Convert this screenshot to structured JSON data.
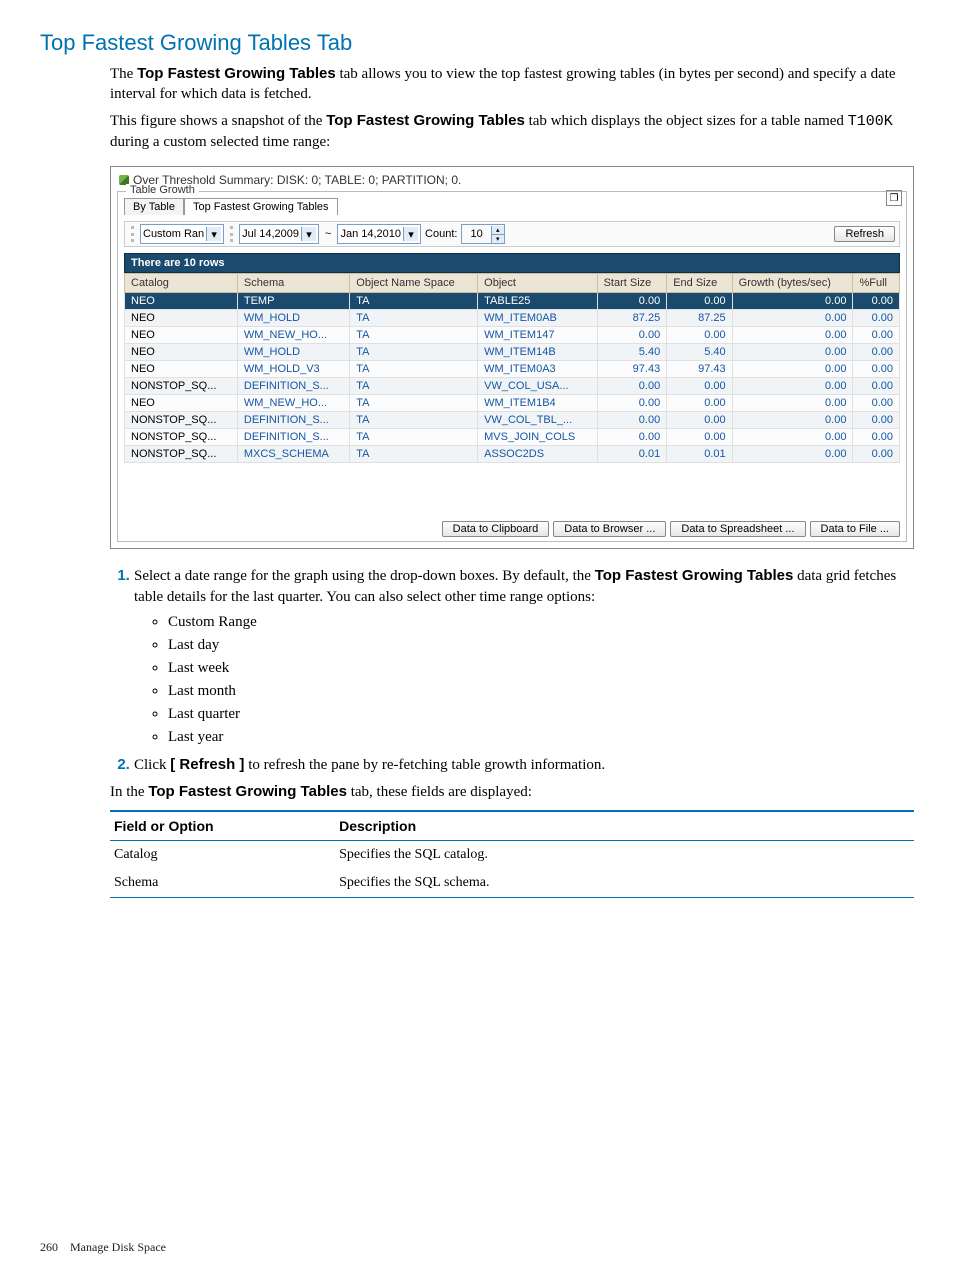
{
  "page": {
    "title": "Top Fastest Growing Tables Tab",
    "intro1_a": "The ",
    "intro1_b": "Top Fastest Growing Tables",
    "intro1_c": " tab allows you to view the top fastest growing tables (in bytes per second) and specify a date interval for which data is fetched.",
    "intro2_a": "This figure shows a snapshot of the ",
    "intro2_b": "Top Fastest Growing Tables",
    "intro2_c": " tab which displays the object sizes for a table named ",
    "intro2_code": "T100K",
    "intro2_d": " during a custom selected time range:",
    "step1_a": "Select a date range for the graph using the drop-down boxes. By default, the ",
    "step1_b": "Top Fastest Growing Tables",
    "step1_c": " data grid fetches table details for the last quarter. You can also select other time range options:",
    "range_options": [
      "Custom Range",
      "Last day",
      "Last week",
      "Last month",
      "Last quarter",
      "Last year"
    ],
    "step2_a": "Click ",
    "step2_b": "[ Refresh ]",
    "step2_c": " to refresh the pane by re-fetching table growth information.",
    "fields_intro_a": "In the ",
    "fields_intro_b": "Top Fastest Growing Tables",
    "fields_intro_c": " tab, these fields are displayed:",
    "field_header1": "Field or Option",
    "field_header2": "Description",
    "fields": [
      {
        "name": "Catalog",
        "desc": "Specifies the SQL catalog."
      },
      {
        "name": "Schema",
        "desc": "Specifies the SQL schema."
      }
    ],
    "footer_page": "260",
    "footer_text": "Manage Disk Space"
  },
  "screenshot": {
    "window_title": "Over Threshold Summary: DISK: 0; TABLE: 0; PARTITION; 0.",
    "fieldset_legend": "Table Growth",
    "tab1": "By Table",
    "tab2": "Top Fastest Growing Tables",
    "range_dropdown": "Custom Ran",
    "date_from": "Jul 14,2009",
    "date_to": "Jan 14,2010",
    "count_label": "Count:",
    "count_value": "10",
    "refresh_btn": "Refresh",
    "rows_label": "There are 10 rows",
    "grid_headers": [
      "Catalog",
      "Schema",
      "Object Name Space",
      "Object",
      "Start Size",
      "End Size",
      "Growth (bytes/sec)",
      "%Full"
    ],
    "grid_rows": [
      {
        "sel": true,
        "cells": [
          "NEO",
          "TEMP",
          "TA",
          "TABLE25",
          "0.00",
          "0.00",
          "0.00",
          "0.00"
        ]
      },
      {
        "sel": false,
        "cells": [
          "NEO",
          "WM_HOLD",
          "TA",
          "WM_ITEM0AB",
          "87.25",
          "87.25",
          "0.00",
          "0.00"
        ]
      },
      {
        "sel": false,
        "cells": [
          "NEO",
          "WM_NEW_HO...",
          "TA",
          "WM_ITEM147",
          "0.00",
          "0.00",
          "0.00",
          "0.00"
        ]
      },
      {
        "sel": false,
        "cells": [
          "NEO",
          "WM_HOLD",
          "TA",
          "WM_ITEM14B",
          "5.40",
          "5.40",
          "0.00",
          "0.00"
        ]
      },
      {
        "sel": false,
        "cells": [
          "NEO",
          "WM_HOLD_V3",
          "TA",
          "WM_ITEM0A3",
          "97.43",
          "97.43",
          "0.00",
          "0.00"
        ]
      },
      {
        "sel": false,
        "cells": [
          "NONSTOP_SQ...",
          "DEFINITION_S...",
          "TA",
          "VW_COL_USA...",
          "0.00",
          "0.00",
          "0.00",
          "0.00"
        ]
      },
      {
        "sel": false,
        "cells": [
          "NEO",
          "WM_NEW_HO...",
          "TA",
          "WM_ITEM1B4",
          "0.00",
          "0.00",
          "0.00",
          "0.00"
        ]
      },
      {
        "sel": false,
        "cells": [
          "NONSTOP_SQ...",
          "DEFINITION_S...",
          "TA",
          "VW_COL_TBL_...",
          "0.00",
          "0.00",
          "0.00",
          "0.00"
        ]
      },
      {
        "sel": false,
        "cells": [
          "NONSTOP_SQ...",
          "DEFINITION_S...",
          "TA",
          "MVS_JOIN_COLS",
          "0.00",
          "0.00",
          "0.00",
          "0.00"
        ]
      },
      {
        "sel": false,
        "cells": [
          "NONSTOP_SQ...",
          "MXCS_SCHEMA",
          "TA",
          "ASSOC2DS",
          "0.01",
          "0.01",
          "0.00",
          "0.00"
        ]
      }
    ],
    "export_buttons": [
      "Data to Clipboard",
      "Data to Browser ...",
      "Data to Spreadsheet ...",
      "Data to File ..."
    ]
  },
  "chart_data": {
    "type": "table",
    "title": "Top Fastest Growing Tables — There are 10 rows",
    "columns": [
      "Catalog",
      "Schema",
      "Object Name Space",
      "Object",
      "Start Size",
      "End Size",
      "Growth (bytes/sec)",
      "%Full"
    ],
    "rows": [
      [
        "NEO",
        "TEMP",
        "TA",
        "TABLE25",
        0.0,
        0.0,
        0.0,
        0.0
      ],
      [
        "NEO",
        "WM_HOLD",
        "TA",
        "WM_ITEM0AB",
        87.25,
        87.25,
        0.0,
        0.0
      ],
      [
        "NEO",
        "WM_NEW_HO...",
        "TA",
        "WM_ITEM147",
        0.0,
        0.0,
        0.0,
        0.0
      ],
      [
        "NEO",
        "WM_HOLD",
        "TA",
        "WM_ITEM14B",
        5.4,
        5.4,
        0.0,
        0.0
      ],
      [
        "NEO",
        "WM_HOLD_V3",
        "TA",
        "WM_ITEM0A3",
        97.43,
        97.43,
        0.0,
        0.0
      ],
      [
        "NONSTOP_SQ...",
        "DEFINITION_S...",
        "TA",
        "VW_COL_USA...",
        0.0,
        0.0,
        0.0,
        0.0
      ],
      [
        "NEO",
        "WM_NEW_HO...",
        "TA",
        "WM_ITEM1B4",
        0.0,
        0.0,
        0.0,
        0.0
      ],
      [
        "NONSTOP_SQ...",
        "DEFINITION_S...",
        "TA",
        "VW_COL_TBL_...",
        0.0,
        0.0,
        0.0,
        0.0
      ],
      [
        "NONSTOP_SQ...",
        "DEFINITION_S...",
        "TA",
        "MVS_JOIN_COLS",
        0.0,
        0.0,
        0.0,
        0.0
      ],
      [
        "NONSTOP_SQ...",
        "MXCS_SCHEMA",
        "TA",
        "ASSOC2DS",
        0.01,
        0.01,
        0.0,
        0.0
      ]
    ]
  }
}
